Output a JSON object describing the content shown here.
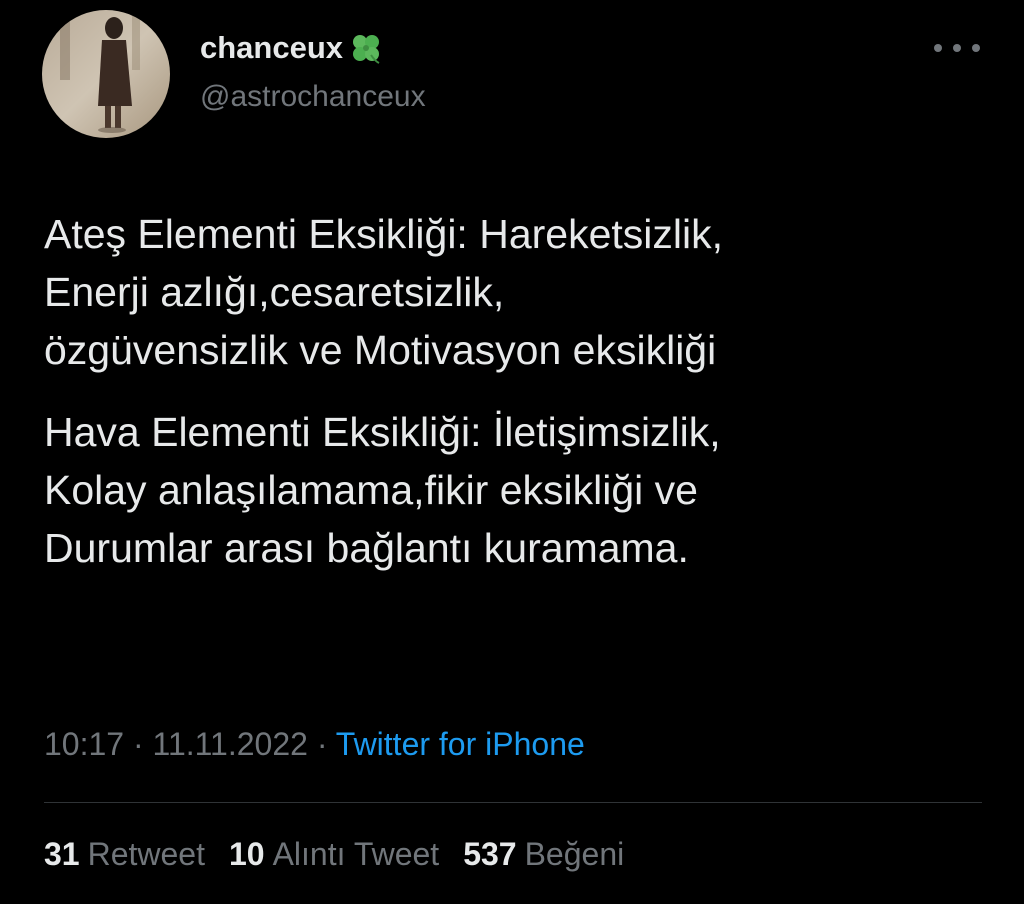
{
  "author": {
    "name": "chanceux",
    "handle": "@astrochanceux",
    "badge_icon": "four-leaf-clover-icon"
  },
  "tweet": {
    "paragraphs": [
      "Ateş Elementi Eksikliği: Hareketsizlik,\nEnerji azlığı,cesaretsizlik,\nözgüvensizlik ve Motivasyon eksikliği",
      "Hava Elementi Eksikliği: İletişimsizlik,\nKolay anlaşılamama,fikir eksikliği ve\nDurumlar arası bağlantı kuramama."
    ]
  },
  "meta": {
    "time": "10:17",
    "separator": " · ",
    "date": "11.11.2022",
    "source": "Twitter for iPhone"
  },
  "stats": {
    "retweets": {
      "count": "31",
      "label": "Retweet"
    },
    "quotes": {
      "count": "10",
      "label": "Alıntı Tweet"
    },
    "likes": {
      "count": "537",
      "label": "Beğeni"
    }
  },
  "colors": {
    "background": "#000000",
    "primary_text": "#e7e9ea",
    "secondary_text": "#71767b",
    "link": "#1d9bf0",
    "clover": "#4caf50"
  }
}
